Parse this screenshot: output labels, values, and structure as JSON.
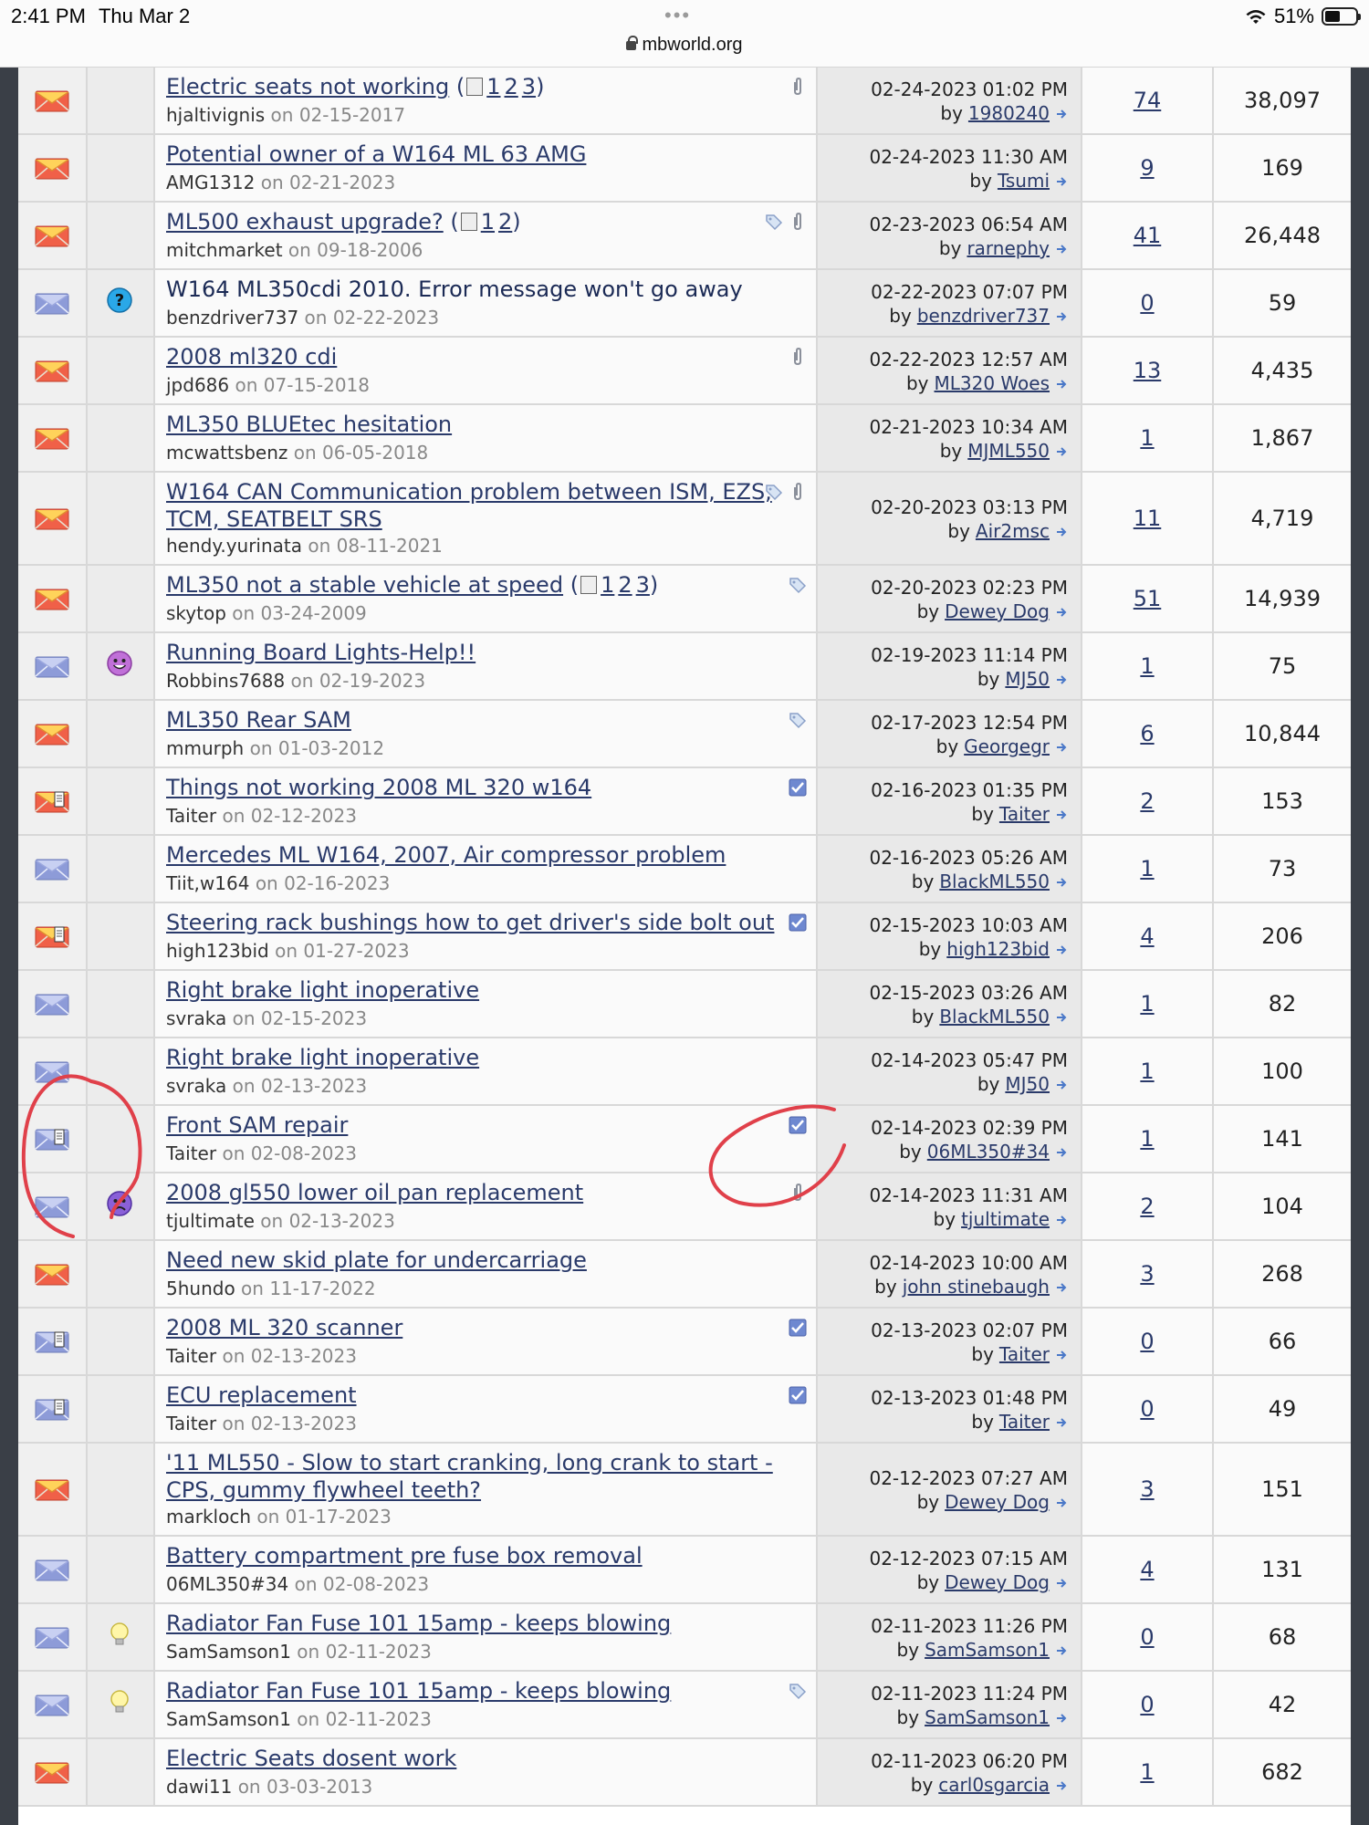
{
  "status_bar": {
    "time": "2:41 PM",
    "day": "Thu Mar 2",
    "url": "mbworld.org",
    "battery": "51%"
  },
  "threads": [
    {
      "title": "Electric seats not working",
      "pages": [
        "1",
        "2",
        "3"
      ],
      "author": "hjaltivignis",
      "started": "02-15-2017",
      "last_date": "02-24-2023 01:02 PM",
      "last_user": "1980240",
      "replies": "74",
      "views": "38,097",
      "status": "hot",
      "post_icon": "",
      "icons": [
        "paperclip"
      ]
    },
    {
      "title": "Potential owner of a W164 ML 63 AMG",
      "pages": [],
      "author": "AMG1312",
      "started": "02-21-2023",
      "last_date": "02-24-2023 11:30 AM",
      "last_user": "Tsumi",
      "replies": "9",
      "views": "169",
      "status": "hot",
      "post_icon": "",
      "icons": []
    },
    {
      "title": "ML500 exhaust upgrade?",
      "pages": [
        "1",
        "2"
      ],
      "author": "mitchmarket",
      "started": "09-18-2006",
      "last_date": "02-23-2023 06:54 AM",
      "last_user": "rarnephy",
      "replies": "41",
      "views": "26,448",
      "status": "hot",
      "post_icon": "",
      "icons": [
        "tag",
        "paperclip"
      ]
    },
    {
      "title": "W164 ML350cdi 2010. Error message won't go away",
      "pages": [],
      "author": "benzdriver737",
      "started": "02-22-2023",
      "last_date": "02-22-2023 07:07 PM",
      "last_user": "benzdriver737",
      "replies": "0",
      "views": "59",
      "status": "new",
      "post_icon": "question",
      "icons": []
    },
    {
      "title": "2008 ml320 cdi",
      "pages": [],
      "author": "jpd686",
      "started": "07-15-2018",
      "last_date": "02-22-2023 12:57 AM",
      "last_user": "ML320 Woes",
      "replies": "13",
      "views": "4,435",
      "status": "hot",
      "post_icon": "",
      "icons": [
        "paperclip"
      ]
    },
    {
      "title": "ML350 BLUEtec hesitation",
      "pages": [],
      "author": "mcwattsbenz",
      "started": "06-05-2018",
      "last_date": "02-21-2023 10:34 AM",
      "last_user": "MJML550",
      "replies": "1",
      "views": "1,867",
      "status": "hot",
      "post_icon": "",
      "icons": []
    },
    {
      "title": "W164 CAN Communication problem between ISM, EZS, TCM, SEATBELT SRS",
      "pages": [],
      "author": "hendy.yurinata",
      "started": "08-11-2021",
      "last_date": "02-20-2023 03:13 PM",
      "last_user": "Air2msc",
      "replies": "11",
      "views": "4,719",
      "status": "hot",
      "post_icon": "",
      "icons": [
        "tag",
        "paperclip"
      ]
    },
    {
      "title": "ML350 not a stable vehicle at speed",
      "pages": [
        "1",
        "2",
        "3"
      ],
      "author": "skytop",
      "started": "03-24-2009",
      "last_date": "02-20-2023 02:23 PM",
      "last_user": "Dewey Dog",
      "replies": "51",
      "views": "14,939",
      "status": "hot",
      "post_icon": "",
      "icons": [
        "tag"
      ]
    },
    {
      "title": "Running Board Lights-Help!!",
      "pages": [],
      "author": "Robbins7688",
      "started": "02-19-2023",
      "last_date": "02-19-2023 11:14 PM",
      "last_user": "MJ50",
      "replies": "1",
      "views": "75",
      "status": "new",
      "post_icon": "smile",
      "icons": []
    },
    {
      "title": "ML350 Rear SAM",
      "pages": [],
      "author": "mmurph",
      "started": "01-03-2012",
      "last_date": "02-17-2023 12:54 PM",
      "last_user": "Georgegr",
      "replies": "6",
      "views": "10,844",
      "status": "hot",
      "post_icon": "",
      "icons": [
        "tag"
      ]
    },
    {
      "title": "Things not working 2008 ML 320 w164",
      "pages": [],
      "author": "Taiter",
      "started": "02-12-2023",
      "last_date": "02-16-2023 01:35 PM",
      "last_user": "Taiter",
      "replies": "2",
      "views": "153",
      "status": "hot-posted",
      "post_icon": "",
      "icons": [
        "check"
      ]
    },
    {
      "title": "Mercedes ML W164, 2007, Air compressor problem",
      "pages": [],
      "author": "Tiit,w164",
      "started": "02-16-2023",
      "last_date": "02-16-2023 05:26 AM",
      "last_user": "BlackML550",
      "replies": "1",
      "views": "73",
      "status": "new",
      "post_icon": "",
      "icons": []
    },
    {
      "title": "Steering rack bushings how to get driver's side bolt out",
      "pages": [],
      "author": "high123bid",
      "started": "01-27-2023",
      "last_date": "02-15-2023 10:03 AM",
      "last_user": "high123bid",
      "replies": "4",
      "views": "206",
      "status": "hot-posted",
      "post_icon": "",
      "icons": [
        "check"
      ]
    },
    {
      "title": "Right brake light inoperative",
      "pages": [],
      "author": "svraka",
      "started": "02-15-2023",
      "last_date": "02-15-2023 03:26 AM",
      "last_user": "BlackML550",
      "replies": "1",
      "views": "82",
      "status": "new",
      "post_icon": "",
      "icons": []
    },
    {
      "title": "Right brake light inoperative",
      "pages": [],
      "author": "svraka",
      "started": "02-13-2023",
      "last_date": "02-14-2023 05:47 PM",
      "last_user": "MJ50",
      "replies": "1",
      "views": "100",
      "status": "new",
      "post_icon": "",
      "icons": []
    },
    {
      "title": "Front SAM repair",
      "pages": [],
      "author": "Taiter",
      "started": "02-08-2023",
      "last_date": "02-14-2023 02:39 PM",
      "last_user": "06ML350#34",
      "replies": "1",
      "views": "141",
      "status": "new-posted",
      "post_icon": "",
      "icons": [
        "check"
      ]
    },
    {
      "title": "2008 gl550 lower oil pan replacement",
      "pages": [],
      "author": "tjultimate",
      "started": "02-13-2023",
      "last_date": "02-14-2023 11:31 AM",
      "last_user": "tjultimate",
      "replies": "2",
      "views": "104",
      "status": "new",
      "post_icon": "sad",
      "icons": [
        "paperclip"
      ]
    },
    {
      "title": "Need new skid plate for undercarriage",
      "pages": [],
      "author": "5hundo",
      "started": "11-17-2022",
      "last_date": "02-14-2023 10:00 AM",
      "last_user": "john stinebaugh",
      "replies": "3",
      "views": "268",
      "status": "hot",
      "post_icon": "",
      "icons": []
    },
    {
      "title": "2008 ML 320 scanner",
      "pages": [],
      "author": "Taiter",
      "started": "02-13-2023",
      "last_date": "02-13-2023 02:07 PM",
      "last_user": "Taiter",
      "replies": "0",
      "views": "66",
      "status": "new-posted",
      "post_icon": "",
      "icons": [
        "check"
      ]
    },
    {
      "title": "ECU replacement",
      "pages": [],
      "author": "Taiter",
      "started": "02-13-2023",
      "last_date": "02-13-2023 01:48 PM",
      "last_user": "Taiter",
      "replies": "0",
      "views": "49",
      "status": "new-posted",
      "post_icon": "",
      "icons": [
        "check"
      ]
    },
    {
      "title": "'11 ML550 - Slow to start cranking, long crank to start - CPS, gummy flywheel teeth?",
      "pages": [],
      "author": "markloch",
      "started": "01-17-2023",
      "last_date": "02-12-2023 07:27 AM",
      "last_user": "Dewey Dog",
      "replies": "3",
      "views": "151",
      "status": "hot",
      "post_icon": "",
      "icons": []
    },
    {
      "title": "Battery compartment pre fuse box removal",
      "pages": [],
      "author": "06ML350#34",
      "started": "02-08-2023",
      "last_date": "02-12-2023 07:15 AM",
      "last_user": "Dewey Dog",
      "replies": "4",
      "views": "131",
      "status": "new",
      "post_icon": "",
      "icons": []
    },
    {
      "title": "Radiator Fan Fuse 101 15amp - keeps blowing",
      "pages": [],
      "author": "SamSamson1",
      "started": "02-11-2023",
      "last_date": "02-11-2023 11:26 PM",
      "last_user": "SamSamson1",
      "replies": "0",
      "views": "68",
      "status": "new",
      "post_icon": "bulb",
      "icons": []
    },
    {
      "title": "Radiator Fan Fuse 101 15amp - keeps blowing",
      "pages": [],
      "author": "SamSamson1",
      "started": "02-11-2023",
      "last_date": "02-11-2023 11:24 PM",
      "last_user": "SamSamson1",
      "replies": "0",
      "views": "42",
      "status": "new",
      "post_icon": "bulb",
      "icons": [
        "tag"
      ]
    },
    {
      "title": "Electric Seats dosent work",
      "pages": [],
      "author": "dawi11",
      "started": "03-03-2013",
      "last_date": "02-11-2023 06:20 PM",
      "last_user": "carl0sgarcia",
      "replies": "1",
      "views": "682",
      "status": "hot",
      "post_icon": "",
      "icons": []
    }
  ],
  "labels": {
    "on": "on",
    "by": "by"
  },
  "colors": {
    "link": "#2a3a6a",
    "annotation": "#e0404a"
  }
}
